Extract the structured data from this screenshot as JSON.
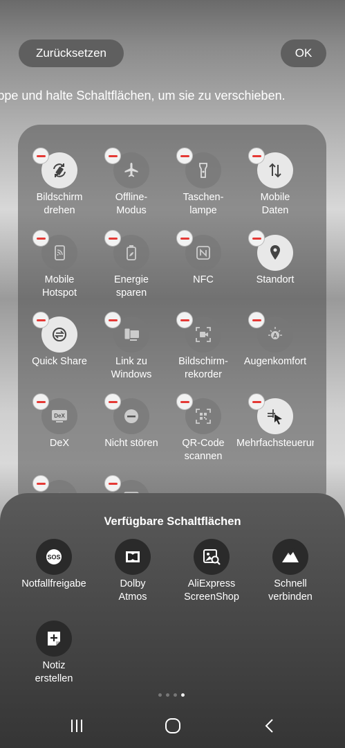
{
  "header": {
    "reset_label": "Zurücksetzen",
    "ok_label": "OK"
  },
  "hint": "Tippe und halte Schaltflächen, um sie zu verschieben.",
  "active_buttons": [
    {
      "label": "Bildschirm\ndrehen",
      "icon": "rotate-icon",
      "active": true
    },
    {
      "label": "Offline-\nModus",
      "icon": "airplane-icon",
      "active": false
    },
    {
      "label": "Taschen-\nlampe",
      "icon": "flashlight-icon",
      "active": false
    },
    {
      "label": "Mobile\nDaten",
      "icon": "mobile-data-icon",
      "active": true
    },
    {
      "label": "Mobile\nHotspot",
      "icon": "hotspot-icon",
      "active": false
    },
    {
      "label": "Energie\nsparen",
      "icon": "battery-leaf-icon",
      "active": false
    },
    {
      "label": "NFC",
      "icon": "nfc-icon",
      "active": false
    },
    {
      "label": "Standort",
      "icon": "location-pin-icon",
      "active": true
    },
    {
      "label": "Quick Share",
      "icon": "quick-share-icon",
      "active": true
    },
    {
      "label": "Link zu\nWindows",
      "icon": "link-to-windows-icon",
      "active": false
    },
    {
      "label": "Bildschirm-\nrekorder",
      "icon": "screen-recorder-icon",
      "active": false
    },
    {
      "label": "Augenkomfort",
      "icon": "eye-comfort-icon",
      "active": false
    },
    {
      "label": "DeX",
      "icon": "dex-icon",
      "active": false
    },
    {
      "label": "Nicht stören",
      "icon": "do-not-disturb-icon",
      "active": false
    },
    {
      "label": "QR-Code\nscannen",
      "icon": "qr-scan-icon",
      "active": false
    },
    {
      "label": "Mehrfachsteuerung",
      "icon": "multi-control-icon",
      "active": true
    },
    {
      "label": "",
      "icon": "wifi-icon",
      "active": false
    },
    {
      "label": "",
      "icon": "screen-cast-icon",
      "active": false
    }
  ],
  "available": {
    "title": "Verfügbare Schaltflächen",
    "items": [
      {
        "label": "Notfallfreigabe",
        "icon": "sos-icon"
      },
      {
        "label": "Dolby\nAtmos",
        "icon": "dolby-icon"
      },
      {
        "label": "AliExpress\nScreenShop",
        "icon": "image-search-icon"
      },
      {
        "label": "Schnell\nverbinden",
        "icon": "mountain-icon"
      },
      {
        "label": "Notiz\nerstellen",
        "icon": "note-add-icon"
      }
    ]
  },
  "pagination": {
    "total": 4,
    "current": 4
  },
  "nav": {
    "recents": "recents-icon",
    "home": "home-icon",
    "back": "back-icon"
  }
}
